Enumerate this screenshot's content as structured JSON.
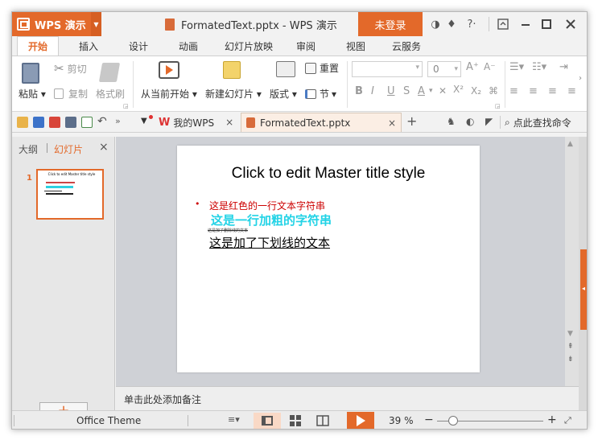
{
  "app": {
    "name": "WPS 演示",
    "doc_title": "FormatedText.pptx - WPS 演示",
    "login_label": "未登录"
  },
  "menu_tabs": [
    "开始",
    "插入",
    "设计",
    "动画",
    "幻灯片放映",
    "审阅",
    "视图",
    "云服务"
  ],
  "ribbon": {
    "paste": "粘贴",
    "cut": "剪切",
    "copy": "复制",
    "format_painter": "格式刷",
    "from_current": "从当前开始",
    "new_slide": "新建幻灯片",
    "layout": "版式",
    "reset": "重置",
    "section": "节",
    "font_size": "0"
  },
  "doc_tabs": {
    "home": "我的WPS",
    "file": "FormatedText.pptx"
  },
  "search_label": "点此查找命令",
  "left_pane": {
    "outline_tab": "大纲",
    "slides_tab": "幻灯片",
    "slide_number": "1",
    "thumb_title": "Click to edit Master title style"
  },
  "slide": {
    "title": "Click to edit Master title style",
    "bullet": "•",
    "line_red": "这是红色的一行文本字符串",
    "line_bold": "这是一行加粗的字符串",
    "line_strike": "这是加了删除线的文本",
    "line_underline": "这是加了下划线的文本"
  },
  "notes_placeholder": "单击此处添加备注",
  "status": {
    "theme": "Office Theme",
    "zoom": "39 %"
  },
  "colors": {
    "accent": "#e3692a",
    "red_text": "#cc0000",
    "cyan_text": "#22d3e6"
  }
}
